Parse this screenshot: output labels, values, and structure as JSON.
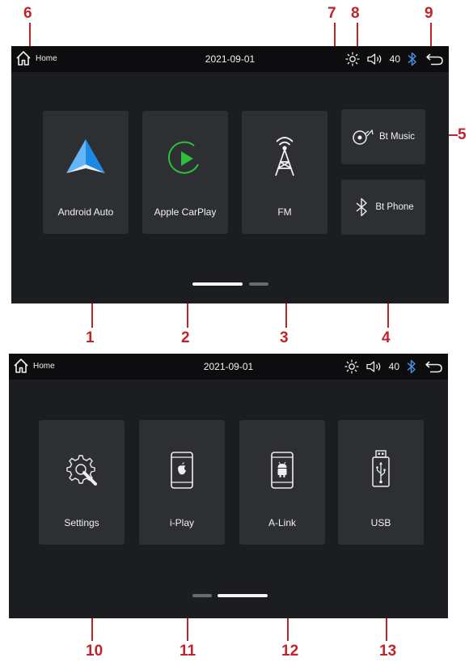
{
  "callouts": [
    "1",
    "2",
    "3",
    "4",
    "5",
    "6",
    "7",
    "8",
    "9",
    "10",
    "11",
    "12",
    "13"
  ],
  "screen1": {
    "statusbar": {
      "home_label": "Home",
      "date": "2021-09-01",
      "volume": "40"
    },
    "apps": {
      "android_auto": "Android Auto",
      "apple_carplay": "Apple CarPlay",
      "fm": "FM",
      "bt_music": "Bt Music",
      "bt_phone": "Bt Phone"
    },
    "page_indicator": {
      "current": 1,
      "total": 2
    }
  },
  "screen2": {
    "statusbar": {
      "home_label": "Home",
      "date": "2021-09-01",
      "volume": "40"
    },
    "apps": {
      "settings": "Settings",
      "iplay": "i-Play",
      "alink": "A-Link",
      "usb": "USB"
    },
    "page_indicator": {
      "current": 2,
      "total": 2
    }
  },
  "colors": {
    "accent_red": "#c0242a",
    "tile": "#2d2f33",
    "bluetooth": "#4a90e2",
    "carplay_green": "#2fbf3a"
  },
  "icons": [
    "home-icon",
    "brightness-icon",
    "volume-icon",
    "bluetooth-icon",
    "back-icon",
    "android-auto-icon",
    "carplay-icon",
    "fm-antenna-icon",
    "bt-music-icon",
    "bt-phone-icon",
    "settings-gear-icon",
    "iplay-phone-icon",
    "alink-phone-icon",
    "usb-icon"
  ]
}
